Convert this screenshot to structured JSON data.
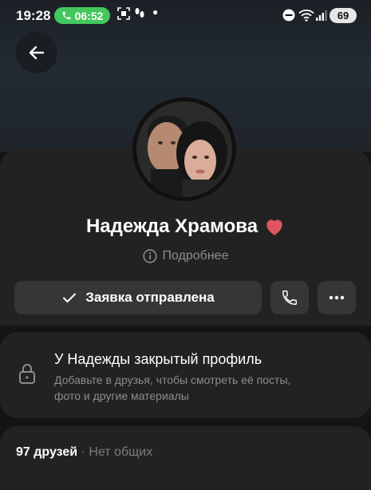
{
  "status_bar": {
    "time": "19:28",
    "call_duration": "06:52",
    "battery_level": "69",
    "call_color": "#42c75c"
  },
  "profile": {
    "name": "Надежда Храмова",
    "more_label": "Подробнее",
    "heart_color": "#e05561"
  },
  "actions": {
    "request_label": "Заявка отправлена"
  },
  "private": {
    "title": "У Надежды закрытый профиль",
    "description": "Добавьте в друзья, чтобы смотреть её посты, фото и другие материалы"
  },
  "friends": {
    "count_label": "97 друзей",
    "separator": "·",
    "common_label": "Нет общих"
  },
  "icons": [
    "phone-icon",
    "screen-record-icon",
    "footsteps-icon",
    "dnd-icon",
    "wifi-icon",
    "signal-icon",
    "arrow-back-icon",
    "heart-icon",
    "info-icon",
    "check-icon",
    "more-icon",
    "lock-icon"
  ]
}
